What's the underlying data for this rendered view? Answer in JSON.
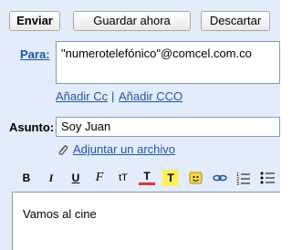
{
  "buttons": {
    "send": "Enviar",
    "save_now": "Guardar ahora",
    "discard": "Descartar"
  },
  "to": {
    "label": "Para:",
    "value": "\"numerotelefónico\"@comcel.com.co"
  },
  "links": {
    "add_cc": "Añadir Cc",
    "separator": "|",
    "add_cco": "Añadir CCO",
    "attach": "Adjuntar un archivo"
  },
  "subject": {
    "label": "Asunto:",
    "value": "Soy Juan"
  },
  "toolbar": {
    "bold": "B",
    "italic": "I",
    "underline": "U",
    "font": "F",
    "size": "tT",
    "color": "T",
    "highlight": "T"
  },
  "message": {
    "body": "Vamos al cine"
  },
  "colors": {
    "background": "#e3ecfa",
    "link": "#2255a4",
    "field_border": "#7f9db9"
  }
}
